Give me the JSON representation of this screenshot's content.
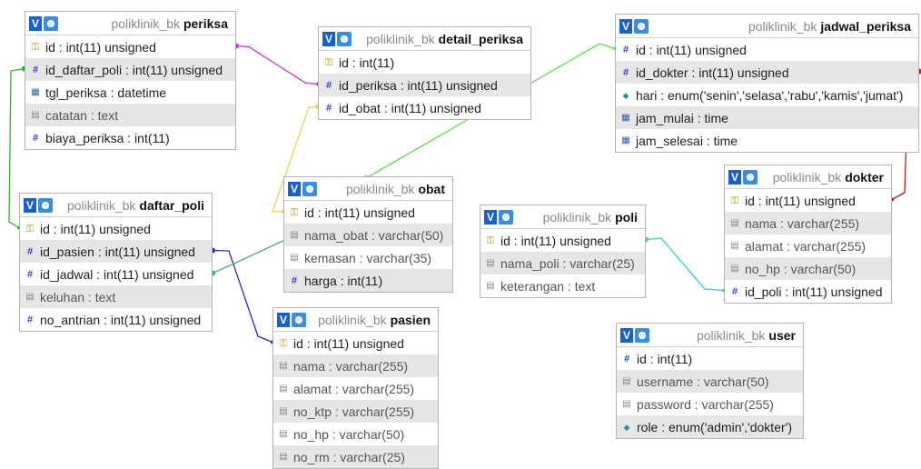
{
  "colors": {
    "link_periksa_detail": "#cc33cc",
    "link_daftar_periksa": "#33aa33",
    "link_detail_obat": "#e6d84a",
    "link_detail_jadwal": "#66dd55",
    "link_jadwal_dokter": "#aa2222",
    "link_daftar_pasien": "#2b2bb5",
    "link_daftar_jadwal": "#55aa77",
    "link_poli_dokter": "#33cccc"
  },
  "tables": {
    "periksa": {
      "db": "poliklinik_bk",
      "name": "periksa",
      "cols": [
        {
          "icon": "key-icon",
          "text": "id : int(11) unsigned"
        },
        {
          "icon": "hash-icon",
          "text": "id_daftar_poli : int(11) unsigned"
        },
        {
          "icon": "date-icon",
          "text": "tgl_periksa : datetime"
        },
        {
          "icon": "text-icon",
          "text": "catatan : text"
        },
        {
          "icon": "hash-icon",
          "text": "biaya_periksa : int(11)"
        }
      ]
    },
    "detail_periksa": {
      "db": "poliklinik_bk",
      "name": "detail_periksa",
      "cols": [
        {
          "icon": "key-icon",
          "text": "id : int(11)"
        },
        {
          "icon": "hash-icon",
          "text": "id_periksa : int(11) unsigned"
        },
        {
          "icon": "hash-icon",
          "text": "id_obat : int(11) unsigned"
        }
      ]
    },
    "jadwal_periksa": {
      "db": "poliklinik_bk",
      "name": "jadwal_periksa",
      "cols": [
        {
          "icon": "hash-icon",
          "text": "id : int(11) unsigned"
        },
        {
          "icon": "hash-icon",
          "text": "id_dokter : int(11) unsigned"
        },
        {
          "icon": "enum-icon",
          "text": "hari : enum('senin','selasa','rabu','kamis','jumat')"
        },
        {
          "icon": "date-icon",
          "text": "jam_mulai : time"
        },
        {
          "icon": "date-icon",
          "text": "jam_selesai : time"
        }
      ]
    },
    "dokter": {
      "db": "poliklinik_bk",
      "name": "dokter",
      "cols": [
        {
          "icon": "key-icon",
          "text": "id : int(11) unsigned"
        },
        {
          "icon": "text-icon",
          "text": "nama : varchar(255)"
        },
        {
          "icon": "text-icon",
          "text": "alamat : varchar(255)"
        },
        {
          "icon": "text-icon",
          "text": "no_hp : varchar(50)"
        },
        {
          "icon": "hash-icon",
          "text": "id_poli : int(11) unsigned"
        }
      ]
    },
    "daftar_poli": {
      "db": "poliklinik_bk",
      "name": "daftar_poli",
      "cols": [
        {
          "icon": "key-icon",
          "text": "id : int(11) unsigned"
        },
        {
          "icon": "hash-icon",
          "text": "id_pasien : int(11) unsigned"
        },
        {
          "icon": "hash-icon",
          "text": "id_jadwal : int(11) unsigned"
        },
        {
          "icon": "text-icon",
          "text": "keluhan : text"
        },
        {
          "icon": "hash-icon",
          "text": "no_antrian : int(11) unsigned"
        }
      ]
    },
    "obat": {
      "db": "poliklinik_bk",
      "name": "obat",
      "cols": [
        {
          "icon": "key-icon",
          "text": "id : int(11) unsigned"
        },
        {
          "icon": "text-icon",
          "text": "nama_obat : varchar(50)"
        },
        {
          "icon": "text-icon",
          "text": "kemasan : varchar(35)"
        },
        {
          "icon": "hash-icon",
          "text": "harga : int(11)"
        }
      ]
    },
    "poli": {
      "db": "poliklinik_bk",
      "name": "poli",
      "cols": [
        {
          "icon": "key-icon",
          "text": "id : int(11) unsigned"
        },
        {
          "icon": "text-icon",
          "text": "nama_poli : varchar(25)"
        },
        {
          "icon": "text-icon",
          "text": "keterangan : text"
        }
      ]
    },
    "pasien": {
      "db": "poliklinik_bk",
      "name": "pasien",
      "cols": [
        {
          "icon": "key-icon",
          "text": "id : int(11) unsigned"
        },
        {
          "icon": "text-icon",
          "text": "nama : varchar(255)"
        },
        {
          "icon": "text-icon",
          "text": "alamat : varchar(255)"
        },
        {
          "icon": "text-icon",
          "text": "no_ktp : varchar(255)"
        },
        {
          "icon": "text-icon",
          "text": "no_hp : varchar(50)"
        },
        {
          "icon": "text-icon",
          "text": "no_rm : varchar(25)"
        }
      ]
    },
    "user": {
      "db": "poliklinik_bk",
      "name": "user",
      "cols": [
        {
          "icon": "hash-icon",
          "text": "id : int(11)"
        },
        {
          "icon": "text-icon",
          "text": "username : varchar(50)"
        },
        {
          "icon": "text-icon",
          "text": "password : varchar(255)"
        },
        {
          "icon": "enum-icon",
          "text": "role : enum('admin','dokter')"
        }
      ]
    }
  },
  "header_icons": {
    "view": "V",
    "settings": "gear-icon"
  }
}
